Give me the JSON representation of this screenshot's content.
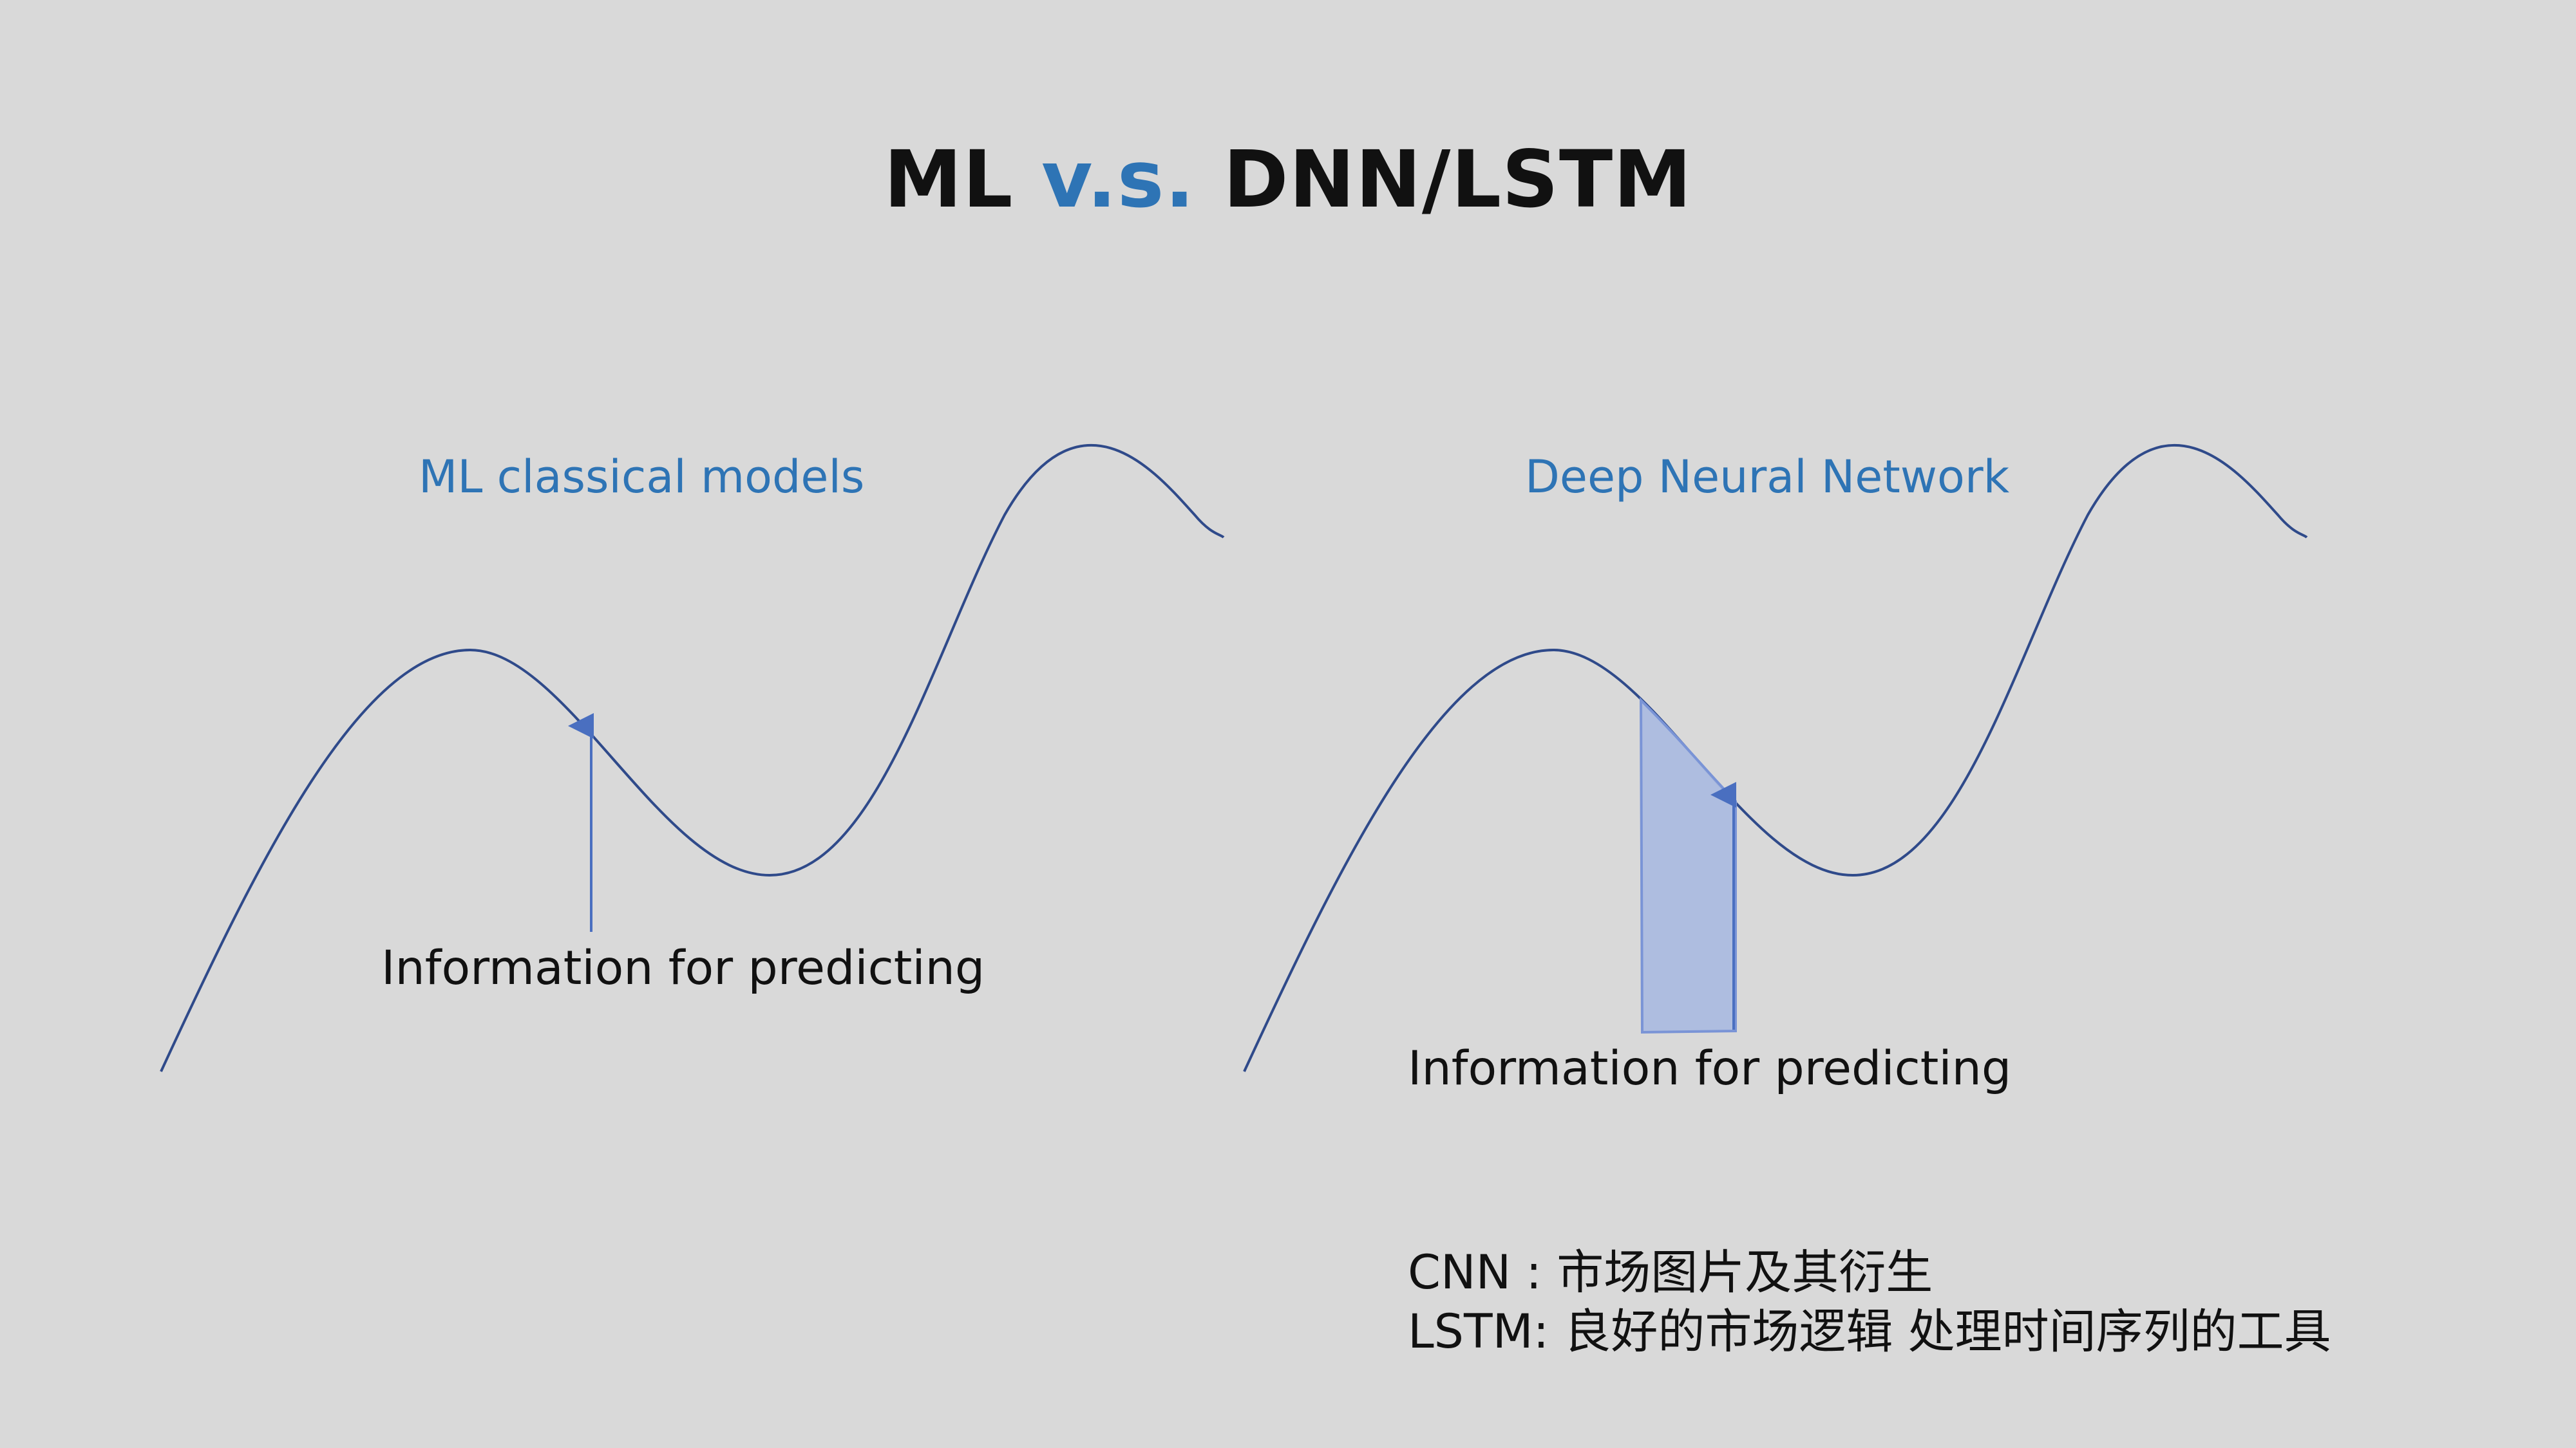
{
  "title": {
    "part1": "ML",
    "part2": "v.s.",
    "part3": "DNN/LSTM"
  },
  "left_panel": {
    "title": "ML classical models",
    "annotation": "Information for predicting"
  },
  "right_panel": {
    "title": "Deep Neural Network",
    "annotation": "Information for predicting"
  },
  "notes": [
    "CNN : 市场图片及其衍生",
    "LSTM:  良好的市场逻辑 处理时间序列的工具"
  ],
  "colors": {
    "curve": "#2f4a8a",
    "accent": "#2e74b5",
    "window_fill": "#a9b9e0",
    "window_stroke": "#7a94d6"
  }
}
